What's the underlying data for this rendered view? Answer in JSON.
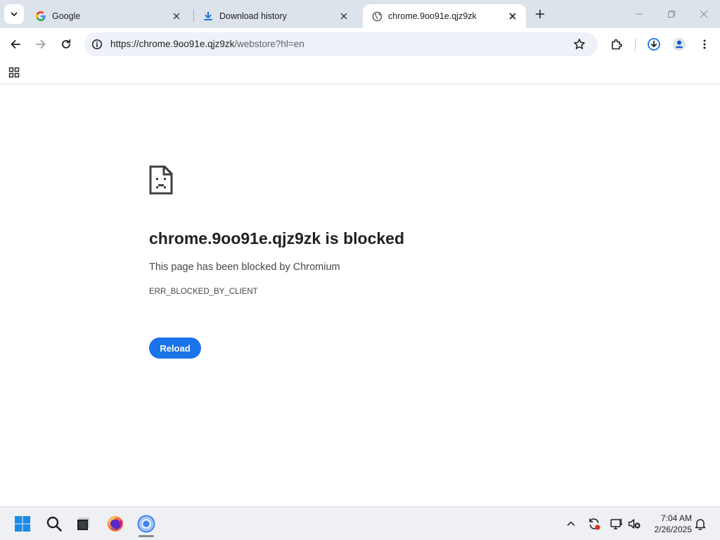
{
  "browser": {
    "tabs": [
      {
        "title": "Google",
        "favicon": "google-g-icon",
        "active": false
      },
      {
        "title": "Download history",
        "favicon": "download-icon",
        "active": false
      },
      {
        "title": "chrome.9oo91e.qjz9zk",
        "favicon": "globe-icon",
        "active": true
      }
    ],
    "omnibox": {
      "url_host": "https://chrome.9oo91e.qjz9zk",
      "url_path": "/webstore?hl=en"
    },
    "toolbar_icons": [
      "back-icon",
      "forward-icon",
      "reload-icon",
      "site-info-icon",
      "bookmark-star-icon",
      "extensions-icon",
      "download-icon",
      "profile-avatar-icon",
      "menu-kebab-icon"
    ],
    "bookmarks_bar_icons": [
      "apps-grid-icon"
    ]
  },
  "error_page": {
    "title": "chrome.9oo91e.qjz9zk is blocked",
    "description": "This page has been blocked by Chromium",
    "error_code": "ERR_BLOCKED_BY_CLIENT",
    "reload_label": "Reload"
  },
  "taskbar": {
    "pinned": [
      "windows-start-icon",
      "search-icon",
      "file-explorer-icon",
      "firefox-icon",
      "chromium-icon"
    ],
    "tray": [
      "show-hidden-icons-chevron",
      "sync-icon",
      "network-icon",
      "volume-muted-icon",
      "notifications-bell-icon"
    ],
    "time": "7:04 AM",
    "date": "2/26/2025"
  },
  "colors": {
    "accent_blue": "#1a73e8",
    "tabstrip_bg": "#dde3ea",
    "omnibox_bg": "#eef1f8",
    "taskbar_bg": "#eef0f4"
  }
}
